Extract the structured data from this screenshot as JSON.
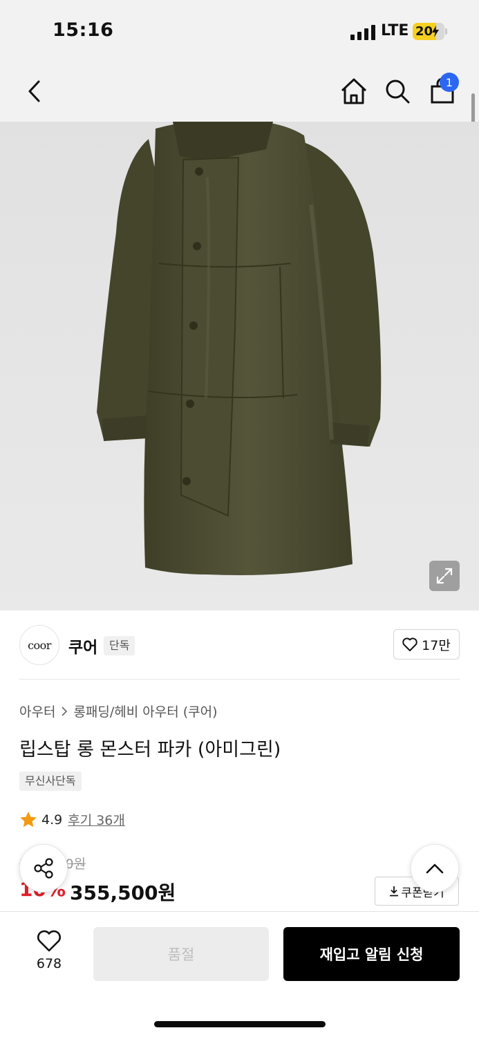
{
  "status_bar": {
    "time": "15:16",
    "network": "LTE",
    "battery": "20"
  },
  "nav": {
    "cart_count": "1"
  },
  "brand": {
    "logo_text": "coor",
    "name": "쿠어",
    "tag": "단독",
    "like_count": "17만"
  },
  "breadcrumb": {
    "category": "아우터",
    "subcategory": "롱패딩/헤비 아우터 (쿠어)"
  },
  "product": {
    "title": "립스탑 롱 몬스터 파카 (아미그린)",
    "exclusive_badge": "무신사단독",
    "rating": "4.9",
    "reviews": "후기 36개",
    "original_price": "395,000원",
    "discount": "10%",
    "sale_price": "355,500원",
    "coupon_label": "쿠폰받기"
  },
  "bottom_bar": {
    "like_count": "678",
    "soldout_label": "품절",
    "restock_label": "재입고 알림 신청"
  },
  "colors": {
    "accent_blue": "#2c67f2",
    "discount_red": "#e0202a",
    "rating_star": "#f29a12",
    "coat": "#4a4a30"
  },
  "icons": [
    "back-icon",
    "home-icon",
    "search-icon",
    "bag-icon",
    "expand-icon",
    "heart-icon",
    "star-icon",
    "download-icon",
    "share-icon",
    "chevron-up-icon"
  ]
}
